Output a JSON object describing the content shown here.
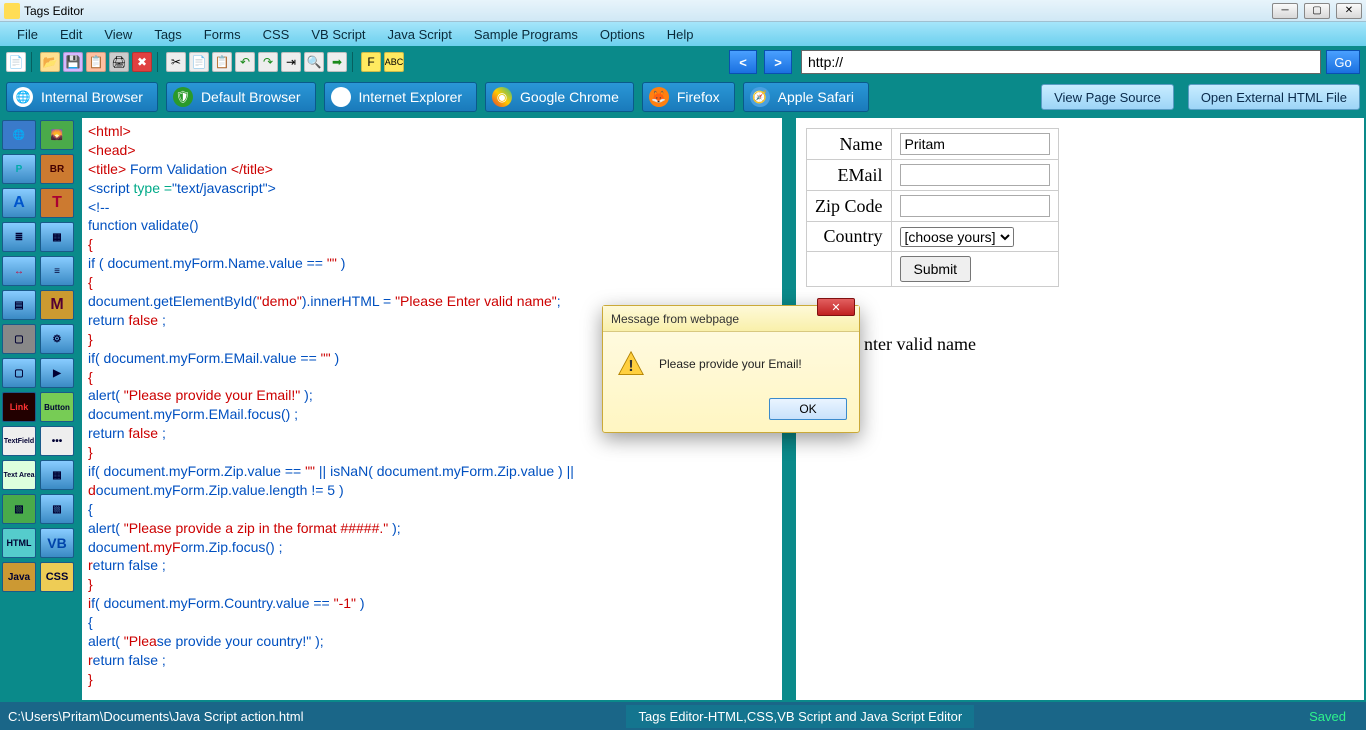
{
  "window": {
    "title": "Tags Editor"
  },
  "menu": [
    "File",
    "Edit",
    "View",
    "Tags",
    "Forms",
    "CSS",
    "VB Script",
    "Java Script",
    "Sample Programs",
    "Options",
    "Help"
  ],
  "nav": {
    "back": "<",
    "fwd": ">",
    "url": "http://",
    "go": "Go"
  },
  "browsers": [
    {
      "name": "internal",
      "label": "Internal Browser"
    },
    {
      "name": "default",
      "label": "Default Browser"
    },
    {
      "name": "ie",
      "label": "Internet Explorer"
    },
    {
      "name": "chrome",
      "label": "Google Chrome"
    },
    {
      "name": "firefox",
      "label": "Firefox"
    },
    {
      "name": "safari",
      "label": "Apple Safari"
    }
  ],
  "rightbtns": {
    "vps": "View Page Source",
    "open": "Open External HTML File"
  },
  "left_tools": [
    "🌐",
    "🌄",
    "P",
    "BR",
    "A",
    "T",
    "≣",
    "▦",
    "↔",
    "≡",
    "▤",
    "M",
    "▢",
    "⚙",
    "▢",
    "▶",
    "Link",
    "Button",
    "TextField",
    "•••",
    "Text Area",
    "▦",
    "▧",
    "▧",
    "HTML",
    "VB",
    "Java",
    "CSS"
  ],
  "code": {
    "l1a": "<html>",
    "l2a": "<head>",
    "l3a": "<title>",
    "l3b": " Form Validation ",
    "l3c": "</title>",
    "l4a": "<script ",
    "l4b": "type =",
    "l4c": "\"text/javascript\">",
    "l5": "<!--",
    "l6a": "function ",
    "l6b": "validate()",
    "l7": "{",
    "l8a": "if ",
    "l8b": "( document.myForm.Name.value == ",
    "l8c": "\"\"",
    "l8d": " )",
    "l9": "{",
    "l10a": " document.getElementById(",
    "l10b": "\"demo\"",
    "l10c": ").innerHTML = ",
    "l10d": "\"Please Enter valid name\"",
    "l10e": ";",
    "l11a": " return ",
    "l11b": "false ",
    "l11c": ";",
    "l12": "}",
    "l13a": "if",
    "l13b": "( document.myForm.EMail.value == ",
    "l13c": "\"\"",
    "l13d": " )",
    "l14": "{",
    "l15a": "alert( ",
    "l15b": "\"Please provide your Email!\"",
    "l15c": " );",
    "l16": "document.myForm.EMail.focus() ;",
    "l17a": "return ",
    "l17b": "false ",
    "l17c": ";",
    "l18": "}",
    "l19a": "if",
    "l19b": "( document.myForm.Zip.value == ",
    "l19c": "\"\"",
    "l19d": " || isNaN( document.myForm.Zip.value ) ||",
    "l20a": "d",
    "l20b": "ocument.myForm.Zip.value.length != 5 )",
    "l21": "{",
    "l22a": "alert( ",
    "l22b": "\"Please provide a zip in the format #####.\"",
    "l22c": " );",
    "l23a": "docume",
    "l23b": "nt.myF",
    "l23c": "orm.Zip.focus() ;",
    "l24a": "r",
    "l24b": "eturn false ;",
    "l25": "}",
    "l26a": "i",
    "l26b": "f( document.myForm.Country.value == ",
    "l26c": "\"-1\"",
    "l26d": " )",
    "l27": "{",
    "l28a": "alert( ",
    "l28b": "\"Plea",
    "l28c": "se provide your country!\"",
    "l28d": " );",
    "l29a": "r",
    "l29b": "eturn false ;",
    "l30": "}"
  },
  "form": {
    "name_lbl": "Name",
    "name_val": "Pritam",
    "email_lbl": "EMail",
    "email_val": "",
    "zip_lbl": "Zip Code",
    "zip_val": "",
    "country_lbl": "Country",
    "country_val": "[choose yours]",
    "submit": "Submit"
  },
  "demo_text": "nter valid name",
  "dialog": {
    "title": "Message from webpage",
    "body": "Please provide your Email!",
    "ok": "OK"
  },
  "status": {
    "path": "C:\\Users\\Pritam\\Documents\\Java Script action.html",
    "mid": "Tags Editor-HTML,CSS,VB Script and Java Script Editor",
    "saved": "Saved"
  }
}
